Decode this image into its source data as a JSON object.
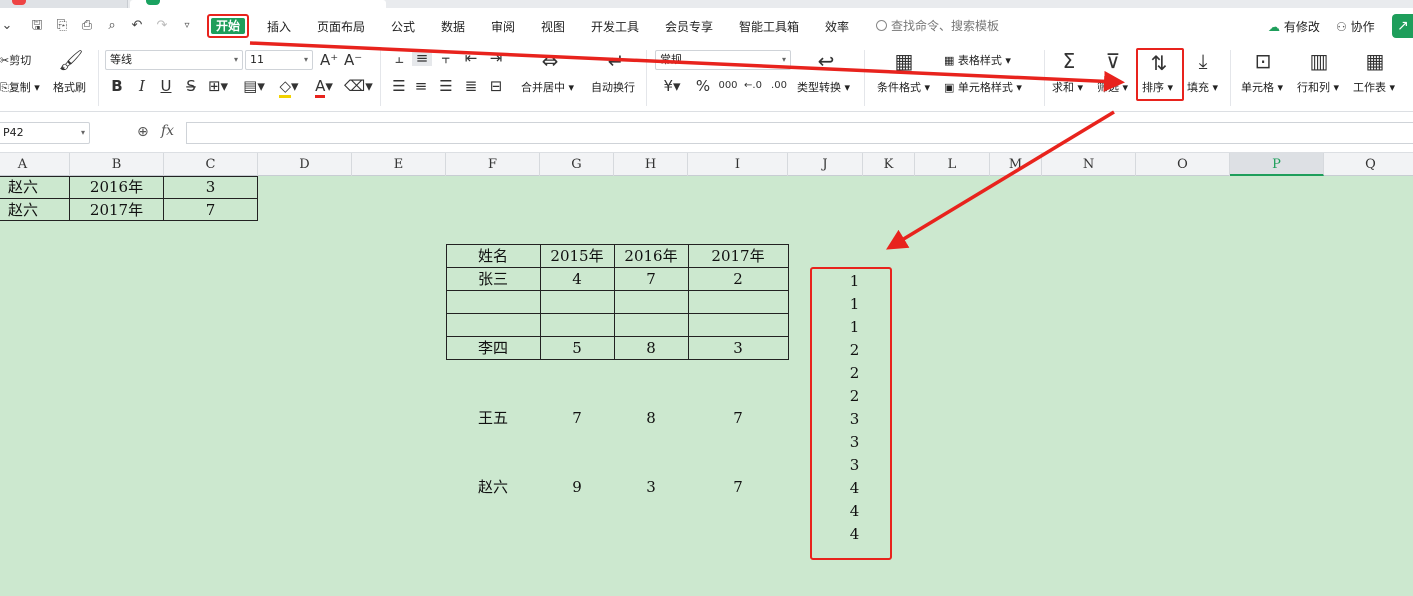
{
  "menu": {
    "tabs": [
      "开始",
      "插入",
      "页面布局",
      "公式",
      "数据",
      "审阅",
      "视图",
      "开发工具",
      "会员专享",
      "智能工具箱",
      "效率"
    ],
    "search_placeholder": "查找命令、搜索模板",
    "modified_label": "有修改",
    "collab_label": "协作"
  },
  "ribbon": {
    "cut": "剪切",
    "copy": "复制",
    "format_painter": "格式刷",
    "font_name": "等线",
    "font_size": "11",
    "number_format": "常规",
    "merge_center": "合并居中",
    "wrap_text": "自动换行",
    "type_convert": "类型转换",
    "conditional_format": "条件格式",
    "table_style": "表格样式",
    "cell_style": "单元格样式",
    "sum": "求和",
    "filter": "筛选",
    "sort": "排序",
    "fill": "填充",
    "cell": "单元格",
    "row_col": "行和列",
    "worksheet": "工作表",
    "bold": "B",
    "italic": "I",
    "underline": "U",
    "currency_sign": "¥",
    "percent_sign": "%",
    "thousands": "000"
  },
  "formula_bar": {
    "name_box": "P42",
    "fx": "fx",
    "value": ""
  },
  "columns": [
    "A",
    "B",
    "C",
    "D",
    "E",
    "F",
    "G",
    "H",
    "I",
    "J",
    "K",
    "L",
    "M",
    "N",
    "O",
    "P",
    "Q"
  ],
  "selected_column": "P",
  "top_rows": [
    [
      "赵六",
      "2016年",
      "3"
    ],
    [
      "赵六",
      "2017年",
      "7"
    ]
  ],
  "table": {
    "header": [
      "姓名",
      "2015年",
      "2016年",
      "2017年"
    ],
    "rows": [
      [
        "张三",
        "4",
        "7",
        "2"
      ],
      [
        "",
        "",
        "",
        ""
      ],
      [
        "",
        "",
        "",
        ""
      ],
      [
        "李四",
        "5",
        "8",
        "3"
      ]
    ]
  },
  "loose_rows": [
    [
      "王五",
      "7",
      "8",
      "7"
    ],
    [
      "赵六",
      "9",
      "3",
      "7"
    ]
  ],
  "sorted_values": [
    "1",
    "1",
    "1",
    "2",
    "2",
    "2",
    "3",
    "3",
    "3",
    "4",
    "4",
    "4"
  ],
  "colors": {
    "accent_green": "#1e9e5b",
    "highlight_red": "#e8231d",
    "sheet_bg": "#cce8cf"
  }
}
